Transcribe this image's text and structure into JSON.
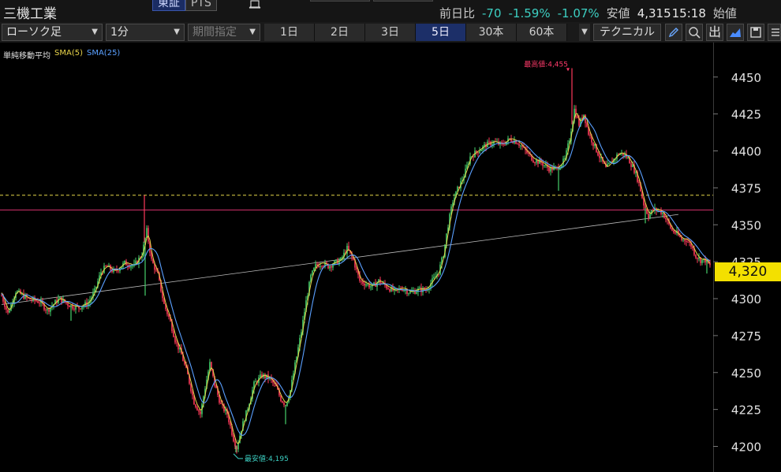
{
  "header": {
    "title": "三機工業",
    "market_tabs": [
      "東証",
      "PTS"
    ],
    "quote": {
      "change_label": "前日比",
      "change": "-70",
      "change_pct": "-1.59%",
      "low_pct": "-1.07%",
      "low_label": "安値",
      "low_value": "4,315",
      "time": "15:18",
      "open_label": "始値"
    }
  },
  "toolbar": {
    "chart_type": "ローソク足",
    "interval": "1分",
    "range": "期間指定",
    "periods": [
      "1日",
      "2日",
      "3日",
      "5日",
      "30本",
      "60本"
    ],
    "active_period": "5日",
    "technical": "テクニカル",
    "tools": [
      "pencil-icon",
      "zoom-icon",
      "volume-icon",
      "area-chart-icon",
      "save-icon",
      "menu-icon"
    ],
    "tool_glyph_volume": "出"
  },
  "legend": {
    "title": "単純移動平均",
    "sma5": "SMA(5)",
    "sma25": "SMA(25)",
    "sma5_color": "#e8d44a",
    "sma25_color": "#5aa0ff"
  },
  "chart_data": {
    "type": "candlestick",
    "ylim": [
      4188,
      4468
    ],
    "y_ticks": [
      4200,
      4225,
      4250,
      4275,
      4300,
      4325,
      4350,
      4375,
      4400,
      4425,
      4450
    ],
    "y_tick_labels": [
      "4200",
      "4225",
      "4250",
      "4275",
      "4300",
      "4325",
      "4350",
      "4375",
      "4400",
      "4425",
      "4450"
    ],
    "close_trace": [
      [
        0,
        4305
      ],
      [
        10,
        4290
      ],
      [
        20,
        4305
      ],
      [
        35,
        4300
      ],
      [
        50,
        4298
      ],
      [
        60,
        4292
      ],
      [
        75,
        4300
      ],
      [
        90,
        4295
      ],
      [
        100,
        4294
      ],
      [
        112,
        4297
      ],
      [
        120,
        4305
      ],
      [
        128,
        4318
      ],
      [
        135,
        4322
      ],
      [
        145,
        4318
      ],
      [
        158,
        4324
      ],
      [
        170,
        4322
      ],
      [
        180,
        4330
      ],
      [
        186,
        4346
      ],
      [
        192,
        4326
      ],
      [
        200,
        4316
      ],
      [
        208,
        4296
      ],
      [
        215,
        4286
      ],
      [
        222,
        4272
      ],
      [
        230,
        4262
      ],
      [
        238,
        4248
      ],
      [
        246,
        4230
      ],
      [
        254,
        4222
      ],
      [
        260,
        4240
      ],
      [
        266,
        4256
      ],
      [
        272,
        4242
      ],
      [
        280,
        4228
      ],
      [
        288,
        4222
      ],
      [
        296,
        4205
      ],
      [
        300,
        4199
      ],
      [
        306,
        4212
      ],
      [
        314,
        4226
      ],
      [
        322,
        4242
      ],
      [
        332,
        4248
      ],
      [
        342,
        4246
      ],
      [
        350,
        4240
      ],
      [
        356,
        4232
      ],
      [
        362,
        4228
      ],
      [
        368,
        4238
      ],
      [
        375,
        4258
      ],
      [
        382,
        4278
      ],
      [
        388,
        4298
      ],
      [
        394,
        4315
      ],
      [
        400,
        4322
      ],
      [
        408,
        4324
      ],
      [
        416,
        4322
      ],
      [
        424,
        4324
      ],
      [
        432,
        4326
      ],
      [
        440,
        4334
      ],
      [
        448,
        4326
      ],
      [
        456,
        4312
      ],
      [
        464,
        4310
      ],
      [
        472,
        4308
      ],
      [
        480,
        4312
      ],
      [
        490,
        4308
      ],
      [
        500,
        4305
      ],
      [
        510,
        4307
      ],
      [
        520,
        4304
      ],
      [
        530,
        4306
      ],
      [
        540,
        4306
      ],
      [
        548,
        4312
      ],
      [
        556,
        4318
      ],
      [
        562,
        4330
      ],
      [
        568,
        4350
      ],
      [
        574,
        4366
      ],
      [
        580,
        4374
      ],
      [
        588,
        4383
      ],
      [
        596,
        4396
      ],
      [
        606,
        4400
      ],
      [
        616,
        4404
      ],
      [
        626,
        4406
      ],
      [
        636,
        4404
      ],
      [
        646,
        4408
      ],
      [
        656,
        4406
      ],
      [
        666,
        4400
      ],
      [
        676,
        4394
      ],
      [
        686,
        4392
      ],
      [
        696,
        4388
      ],
      [
        706,
        4388
      ],
      [
        716,
        4394
      ],
      [
        722,
        4408
      ],
      [
        728,
        4428
      ],
      [
        734,
        4418
      ],
      [
        740,
        4425
      ],
      [
        746,
        4412
      ],
      [
        752,
        4405
      ],
      [
        760,
        4396
      ],
      [
        768,
        4388
      ],
      [
        776,
        4393
      ],
      [
        784,
        4398
      ],
      [
        790,
        4398
      ],
      [
        796,
        4395
      ],
      [
        804,
        4387
      ],
      [
        810,
        4378
      ],
      [
        816,
        4364
      ],
      [
        822,
        4356
      ],
      [
        828,
        4360
      ],
      [
        834,
        4360
      ],
      [
        840,
        4358
      ],
      [
        846,
        4352
      ],
      [
        852,
        4346
      ],
      [
        858,
        4344
      ],
      [
        864,
        4340
      ],
      [
        870,
        4340
      ],
      [
        876,
        4336
      ],
      [
        882,
        4329
      ],
      [
        888,
        4326
      ],
      [
        894,
        4326
      ],
      [
        900,
        4322
      ]
    ],
    "spikes": [
      [
        183,
        4370
      ],
      [
        184,
        4302
      ],
      [
        725,
        4456
      ],
      [
        299,
        4196
      ],
      [
        362,
        4215
      ],
      [
        90,
        4285
      ],
      [
        708,
        4373
      ],
      [
        818,
        4351
      ],
      [
        896,
        4317
      ]
    ],
    "sma_lines": {
      "day_high": 4370,
      "prev_close": 4360
    },
    "trendline": [
      [
        2,
        4296
      ],
      [
        860,
        4357
      ]
    ],
    "annotations": {
      "high_label": "最高値:4,455",
      "high_x": 720,
      "high_value": 4455,
      "low_label": "最安値:4,195",
      "low_x": 296,
      "low_value": 4195
    },
    "last_price": "4,320"
  },
  "colors": {
    "up": "#46d06c",
    "down": "#ff3a5a",
    "day_high_line": "#e6d84a",
    "prev_close_line": "#d0306a",
    "trendline": "#bbbbbb",
    "price_badge": "#f3e000",
    "high_ann": "#ff3a6a",
    "low_ann": "#3ccfc2"
  }
}
